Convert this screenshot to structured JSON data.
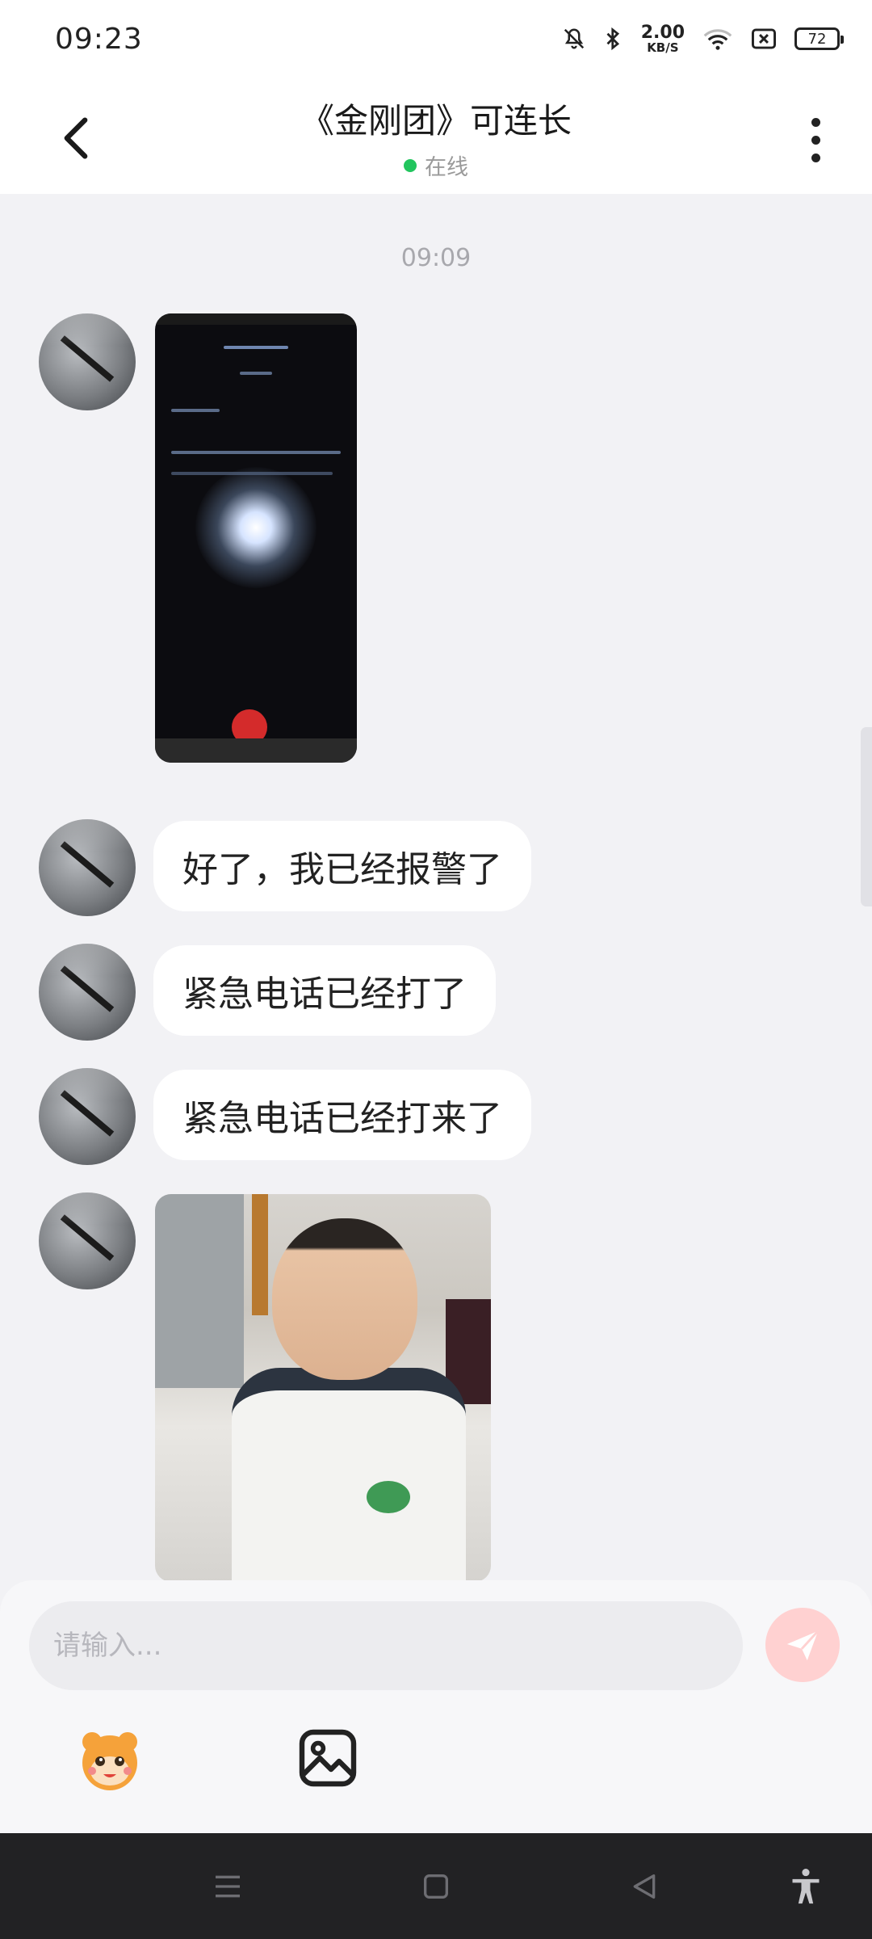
{
  "status_bar": {
    "time": "09:23",
    "net_speed_value": "2.00",
    "net_speed_unit": "KB/S",
    "battery": "72",
    "icons": [
      "mute-bell-icon",
      "bluetooth-icon",
      "wifi-icon",
      "sim-x-icon",
      "battery-icon"
    ]
  },
  "header": {
    "title": "《金刚团》可连长",
    "status": "在线",
    "status_color": "#22c55e"
  },
  "chat": {
    "timestamp": "09:09",
    "messages": [
      {
        "type": "image",
        "description_icon": "call-screenshot-image"
      },
      {
        "type": "text",
        "text": "好了，我已经报警了"
      },
      {
        "type": "text",
        "text": "紧急电话已经打了"
      },
      {
        "type": "text",
        "text": "紧急电话已经打来了"
      },
      {
        "type": "image",
        "description_icon": "photo-image"
      }
    ]
  },
  "input": {
    "placeholder": "请输入...",
    "send_color": "#ffd1d1"
  },
  "toolbar": {
    "items": [
      "emoji-mascot-icon",
      "image-picker-icon"
    ]
  },
  "nav": {
    "items": [
      "menu-icon",
      "home-icon",
      "back-triangle-icon",
      "accessibility-icon"
    ]
  }
}
